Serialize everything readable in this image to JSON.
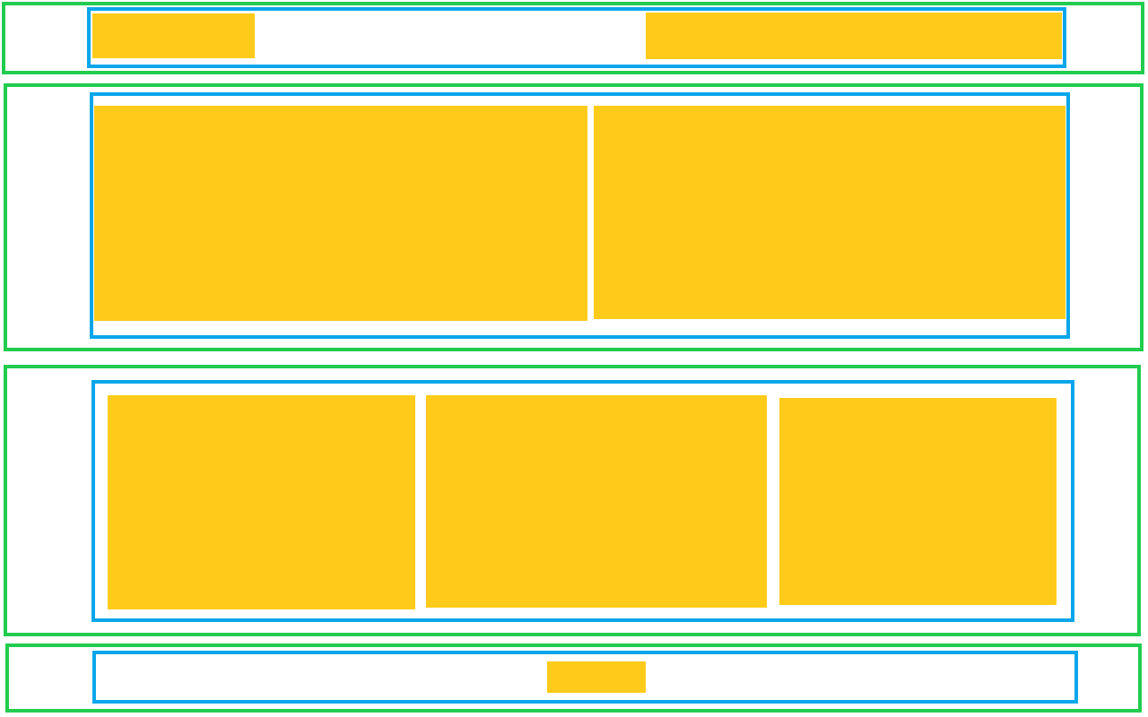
{
  "colors": {
    "section_outline": "#21cc4f",
    "container_outline": "#0aa6eb",
    "content_block_fill": "#fecb1a",
    "background": "#ffffff"
  },
  "rows": [
    {
      "name": "header",
      "content_blocks": 2
    },
    {
      "name": "two-column",
      "content_blocks": 2
    },
    {
      "name": "three-column",
      "content_blocks": 3
    },
    {
      "name": "footer",
      "content_blocks": 1
    }
  ]
}
